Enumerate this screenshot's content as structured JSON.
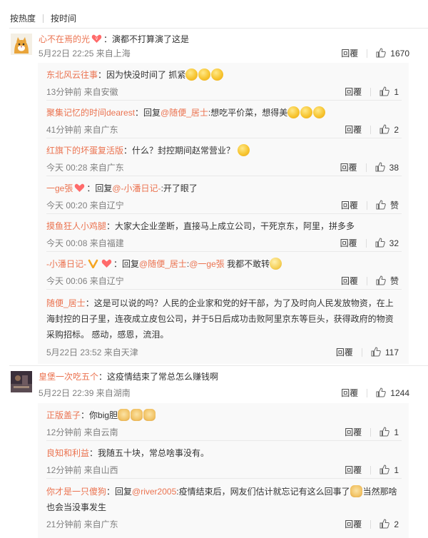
{
  "sort": {
    "hot": "按热度",
    "time": "按时间"
  },
  "actions": {
    "reply": "回覆"
  },
  "icons": {
    "like": "thumbs-up-icon",
    "accent": "#eb7350"
  },
  "comments": [
    {
      "user": "心不在焉的光",
      "text": "：演都不打算演了这是",
      "time": "5月22日 22:25 来自上海",
      "likes": "1670",
      "replies": [
        {
          "user": "东北风云往事",
          "text": "：因为快没时间了 抓紧",
          "time": "13分钟前 来自安徽",
          "likes": "1"
        },
        {
          "user": "聚集记忆的时间dearest",
          "pre": "：回复",
          "mention": "@随便_居士",
          "text": ":想吃平价菜，想得美",
          "time": "41分钟前 来自广东",
          "likes": "2"
        },
        {
          "user": "红旗下的坏蛋复活版",
          "text": "：什么？封控期间赵常营业？",
          "time": "今天 00:28 来自广东",
          "likes": "38"
        },
        {
          "user": "一ge張",
          "pre": "：回复",
          "mention": "@-小潘日记-",
          "text": ":开了眼了",
          "time": "今天 00:20 来自辽宁",
          "likes": "赞"
        },
        {
          "user": "摸鱼狂人小鸡腿",
          "text": "：大家大企业垄断，直接马上成立公司，干死京东，阿里，拼多多",
          "time": "今天 00:08 来自福建",
          "likes": "32"
        },
        {
          "user": "-小潘日记-",
          "pre": "：回复",
          "mention": "@随便_居士",
          "mention2": "@一ge張",
          "text": "我都不敢转",
          "time": "今天 00:06 来自辽宁",
          "likes": "赞"
        },
        {
          "user": "随便_居士",
          "text1": "：这是可以说的吗？人民的企业家和党的好干部，为了及时向人民发放物资，在上",
          "text2": "海封控的日子里，连夜成立皮包公司，并于5日后成功击败阿里京东等巨头，获得政府的物资",
          "text3": "采购招标。 感动，感恩，流泪。",
          "time": "5月22日 23:52 来自天津",
          "likes": "117"
        }
      ]
    },
    {
      "user": "皇堡一次吃五个",
      "text": "：这疫情结束了常总怎么赚钱啊",
      "time": "5月22日 22:39 来自湖南",
      "likes": "1244",
      "replies": [
        {
          "user": "正版盖子",
          "text": "：你big胆",
          "time": "12分钟前 来自云南",
          "likes": "1"
        },
        {
          "user": "良知和利益",
          "text": "：我随五十块，常总啥事没有。",
          "time": "12分钟前 来自山西",
          "likes": "1"
        },
        {
          "user": "你才是一只傻狗",
          "pre": "：回复",
          "mention": "@river2005",
          "text1": ":疫情结束后，网友们估计就忘记有这么回事了",
          "text1b": "当然那啥",
          "text2": "也会当没事发生",
          "time": "21分钟前 来自广东",
          "likes": "2"
        }
      ]
    }
  ]
}
